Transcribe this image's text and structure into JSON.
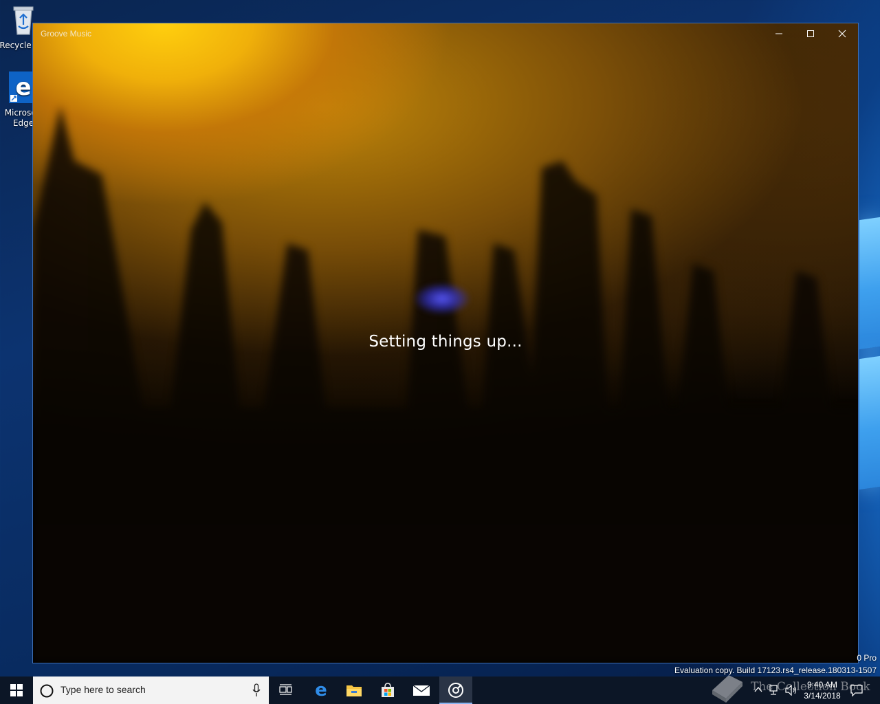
{
  "desktop": {
    "icons": [
      {
        "label": "Recycle Bin",
        "icon": "recycle-bin-icon"
      },
      {
        "label": "Microsoft Edge",
        "icon": "edge-icon"
      }
    ]
  },
  "window": {
    "title": "Groove Music",
    "status_text": "Setting things up...",
    "controls": {
      "minimize": "minimize-icon",
      "maximize": "maximize-icon",
      "close": "close-icon"
    }
  },
  "watermark": {
    "edition": "0 Pro",
    "build": "Evaluation copy. Build 17123.rs4_release.180313-1507"
  },
  "taskbar": {
    "search_placeholder": "Type here to search",
    "pinned": [
      {
        "name": "Task View",
        "icon": "task-view-icon"
      },
      {
        "name": "Microsoft Edge",
        "icon": "edge-icon"
      },
      {
        "name": "File Explorer",
        "icon": "folder-icon"
      },
      {
        "name": "Microsoft Store",
        "icon": "store-icon"
      },
      {
        "name": "Mail",
        "icon": "mail-icon"
      },
      {
        "name": "Groove Music",
        "icon": "groove-music-icon",
        "active": true
      }
    ],
    "clock": {
      "time": "9:40 AM",
      "date": "3/14/2018"
    }
  },
  "overlay_logo": {
    "text": "The Collection Book"
  }
}
